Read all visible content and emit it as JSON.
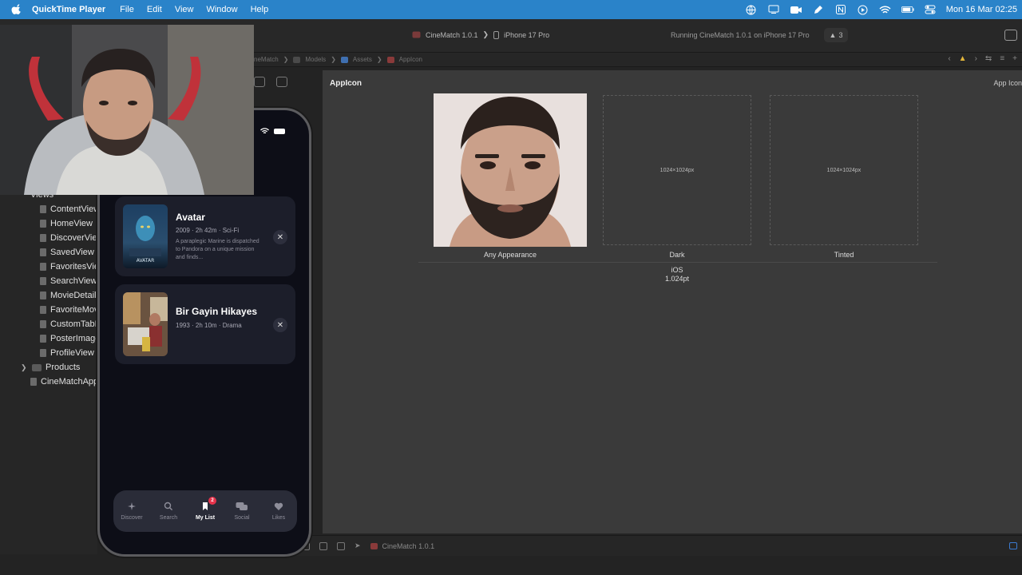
{
  "menubar": {
    "app": "QuickTime Player",
    "menus": [
      "File",
      "Edit",
      "View",
      "Window",
      "Help"
    ],
    "clock": "Mon 16 Mar  02:25"
  },
  "toolbar": {
    "scheme": "CineMatch 1.0.1",
    "device": "iPhone 17 Pro",
    "status": "Running CineMatch 1.0.1 on iPhone 17 Pro",
    "warnings": "3"
  },
  "jumpbar": {
    "crumbs": [
      "neMatch",
      "Models",
      "Assets",
      "AppIcon"
    ]
  },
  "navigator": {
    "group": "Views",
    "files": [
      "ContentView",
      "HomeView",
      "DiscoverView",
      "SavedView",
      "FavoritesView",
      "SearchView",
      "MovieDetail",
      "FavoriteMov",
      "CustomTabB",
      "PosterImage",
      "ProfileView"
    ],
    "products": "Products",
    "app_file": "CineMatchApp"
  },
  "editor": {
    "title": "AppIcon",
    "right_label": "App Icon",
    "wells": [
      {
        "label": "Any Appearance",
        "size": ""
      },
      {
        "label": "Dark",
        "size": "1024×1024px"
      },
      {
        "label": "Tinted",
        "size": "1024×1024px"
      }
    ],
    "platform": "iOS",
    "platform_size": "1.024pt"
  },
  "debugbar": {
    "target": "CineMatch 1.0.1"
  },
  "phone": {
    "movies": [
      {
        "title": "Avatar",
        "meta": "2009 · 2h 42m · Sci-Fi",
        "desc": "A paraplegic Marine is dispatched to Pandora on a unique mission and finds...",
        "poster_text": "AVATAR"
      },
      {
        "title": "Bir Gayin Hikayes",
        "meta": "1993 · 2h 10m · Drama",
        "desc": "",
        "poster_text": ""
      }
    ],
    "tabs": [
      {
        "label": "Discover",
        "icon": "sparkles-icon"
      },
      {
        "label": "Search",
        "icon": "magnifier-icon"
      },
      {
        "label": "My List",
        "icon": "bookmark-icon",
        "badge": "2",
        "active": true
      },
      {
        "label": "Social",
        "icon": "chat-bubbles-icon"
      },
      {
        "label": "Likes",
        "icon": "heart-icon"
      }
    ]
  },
  "colors": {
    "menubar": "#2a83c9",
    "editor_bg": "#3a3a3a",
    "phone_bg": "#0d0e17",
    "badge": "#e5334b"
  }
}
